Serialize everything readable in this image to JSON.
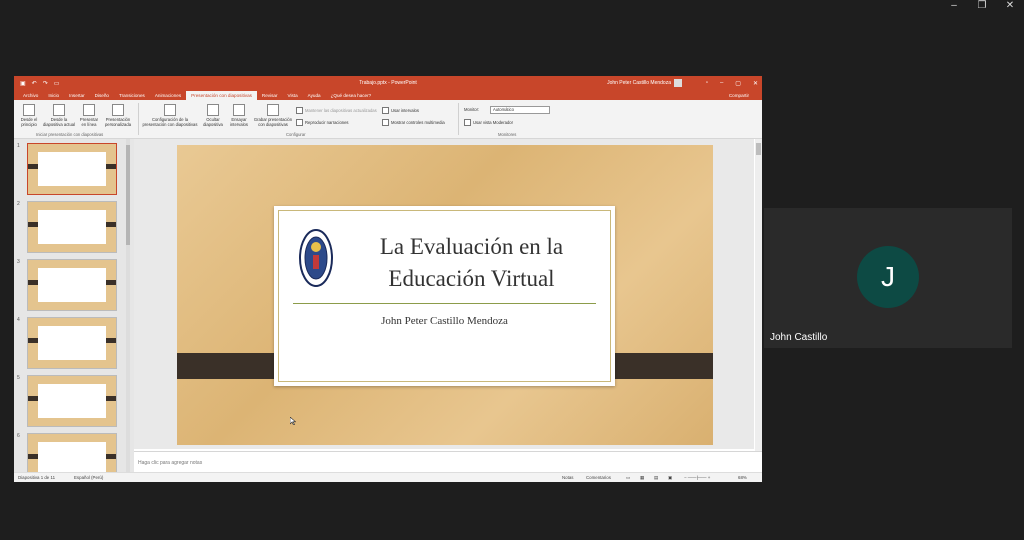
{
  "window_controls": {
    "minimize": "–",
    "restore": "❐",
    "close": "✕"
  },
  "ppt": {
    "title": "Trabajo.pptx - PowerPoint",
    "user": "John Peter Castillo Mendoza",
    "tabs": [
      "Archivo",
      "Inicio",
      "Insertar",
      "Diseño",
      "Transiciones",
      "Animaciones",
      "Presentación con diapositivas",
      "Revisar",
      "Vista",
      "Ayuda",
      "¿Qué desea hacer?"
    ],
    "share": "Compartir",
    "ribbon": {
      "btn_desde_principio": "Desde el principio",
      "btn_desde_actual": "Desde la diapositiva actual",
      "btn_presentar_linea": "Presentar en línea",
      "btn_personalizada": "Presentación personalizada",
      "grp_iniciar": "Iniciar presentación con diapositivas",
      "btn_configuracion": "Configuración de la presentación con diapositivas",
      "btn_ocultar": "Ocultar diapositiva",
      "btn_ensayar": "Ensayar intervalos",
      "btn_grabar": "Grabar presentación con diapositivas",
      "chk_reproducir": "Reproducir narraciones",
      "chk_usar_intervalos": "Usar intervalos",
      "chk_mostrar_controles": "Mostrar controles multimedia",
      "chk_mantener": "Mantener las diapositivas actualizadas",
      "grp_configurar": "Configurar",
      "monitor_label": "Monitor:",
      "monitor_value": "Automático",
      "chk_moderador": "Usar vista Moderador",
      "grp_monitores": "Monitores"
    },
    "slide": {
      "title": "La Evaluación en la Educación Virtual",
      "author": "John Peter Castillo Mendoza"
    },
    "thumbnails": [
      "1",
      "2",
      "3",
      "4",
      "5",
      "6"
    ],
    "notes_placeholder": "Haga clic para agregar notas",
    "status": {
      "slide_counter": "Diapositiva 1 de 11",
      "language": "Español (Perú)",
      "notes": "Notas",
      "comments": "Comentarios",
      "zoom": "68%"
    }
  },
  "participant": {
    "initial": "J",
    "name": "John Castillo",
    "avatar_color": "#0d4a44"
  }
}
